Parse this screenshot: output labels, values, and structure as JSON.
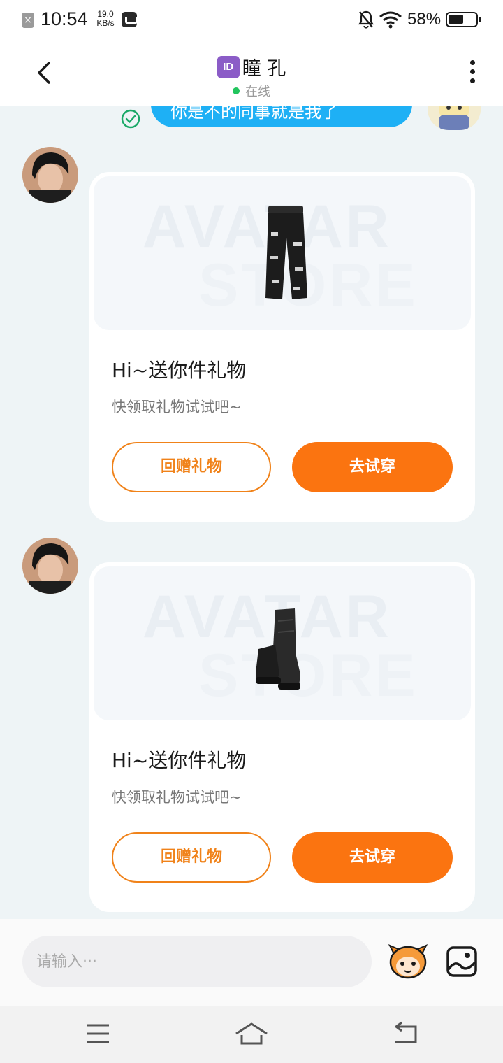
{
  "status_bar": {
    "time": "10:54",
    "net_speed_value": "19.0",
    "net_speed_unit": "KB/s",
    "battery": "58%",
    "battery_level": 0.58
  },
  "header": {
    "id_badge": "ID",
    "contact_name": "瞳 孔",
    "status": "在线"
  },
  "chat": {
    "partial_sent_message": "你是不的同事就是我了",
    "gift_messages": [
      {
        "title": "Hi~送你件礼物",
        "subtitle": "快领取礼物试试吧~",
        "item_icon": "jeans-icon",
        "watermark": [
          "AVATAR",
          "STORE"
        ],
        "gift_back_label": "回赠礼物",
        "try_on_label": "去试穿"
      },
      {
        "title": "Hi~送你件礼物",
        "subtitle": "快领取礼物试试吧~",
        "item_icon": "boots-icon",
        "watermark": [
          "AVATAR",
          "STORE"
        ],
        "gift_back_label": "回赠礼物",
        "try_on_label": "去试穿"
      }
    ]
  },
  "input_bar": {
    "placeholder": "请输入···"
  },
  "colors": {
    "accent_orange": "#fb7410",
    "bubble_blue": "#1eb0f5",
    "online_green": "#22c55e"
  }
}
